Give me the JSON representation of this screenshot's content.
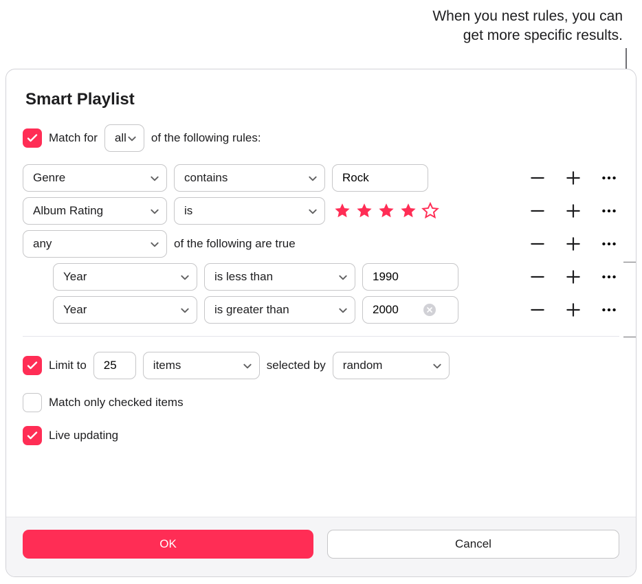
{
  "callout": {
    "line1": "When you nest rules, you can",
    "line2": "get more specific results."
  },
  "dialog": {
    "title": "Smart Playlist",
    "match": {
      "checked": true,
      "prefix": "Match for",
      "mode": "all",
      "suffix": "of the following rules:"
    },
    "rules": [
      {
        "field": "Genre",
        "operator": "contains",
        "value_type": "text",
        "value": "Rock",
        "show_clear": false
      },
      {
        "field": "Album Rating",
        "operator": "is",
        "value_type": "stars",
        "stars": 4
      }
    ],
    "nested": {
      "mode": "any",
      "suffix": "of the following are true",
      "rules": [
        {
          "field": "Year",
          "operator": "is less than",
          "value": "1990",
          "show_clear": false
        },
        {
          "field": "Year",
          "operator": "is greater than",
          "value": "2000",
          "show_clear": true
        }
      ]
    },
    "limit": {
      "checked": true,
      "label": "Limit to",
      "value": "25",
      "unit": "items",
      "selected_by_label": "selected by",
      "sort": "random"
    },
    "match_only_checked": {
      "checked": false,
      "label": "Match only checked items"
    },
    "live_updating": {
      "checked": true,
      "label": "Live updating"
    },
    "buttons": {
      "ok": "OK",
      "cancel": "Cancel"
    }
  }
}
